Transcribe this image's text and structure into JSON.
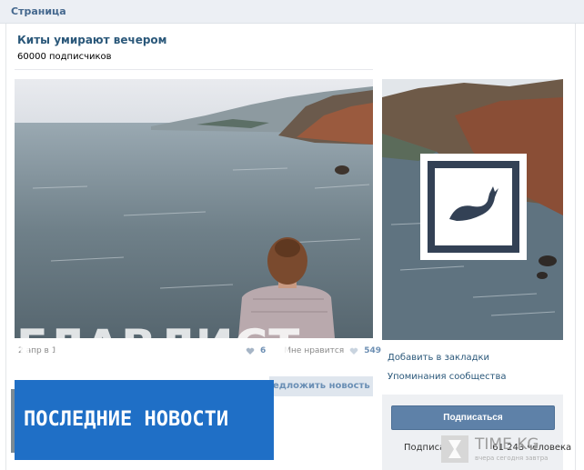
{
  "header": {
    "title": "Страница"
  },
  "community": {
    "name": "Киты умирают вечером",
    "subscribers_line": "60000 подписчиков"
  },
  "post": {
    "date": "2 апр в 1",
    "likes_small": "6",
    "like_label": "Мне нравится",
    "likes": "549",
    "suggest_label": "едложить новость"
  },
  "overlay": {
    "watermark": "ГЛАВЛИСТ",
    "banner": "ПОСЛЕДНИЕ НОВОСТИ"
  },
  "sidebar": {
    "bookmark_link": "Добавить в закладки",
    "mentions_link": "Упоминания сообщества",
    "subscribe_button": "Подписаться",
    "subscribed_prefix": "Подписа",
    "subscribed_count": "61 243 человека"
  },
  "brand": {
    "name": "TIME.KG",
    "tagline": "вчера сегодня завтра"
  },
  "icons": {
    "whale": "whale-icon",
    "heart": "heart-icon",
    "hourglass": "hourglass-icon"
  },
  "colors": {
    "link": "#2b587a",
    "button": "#5e81a8",
    "banner": "#1f6fc6"
  }
}
